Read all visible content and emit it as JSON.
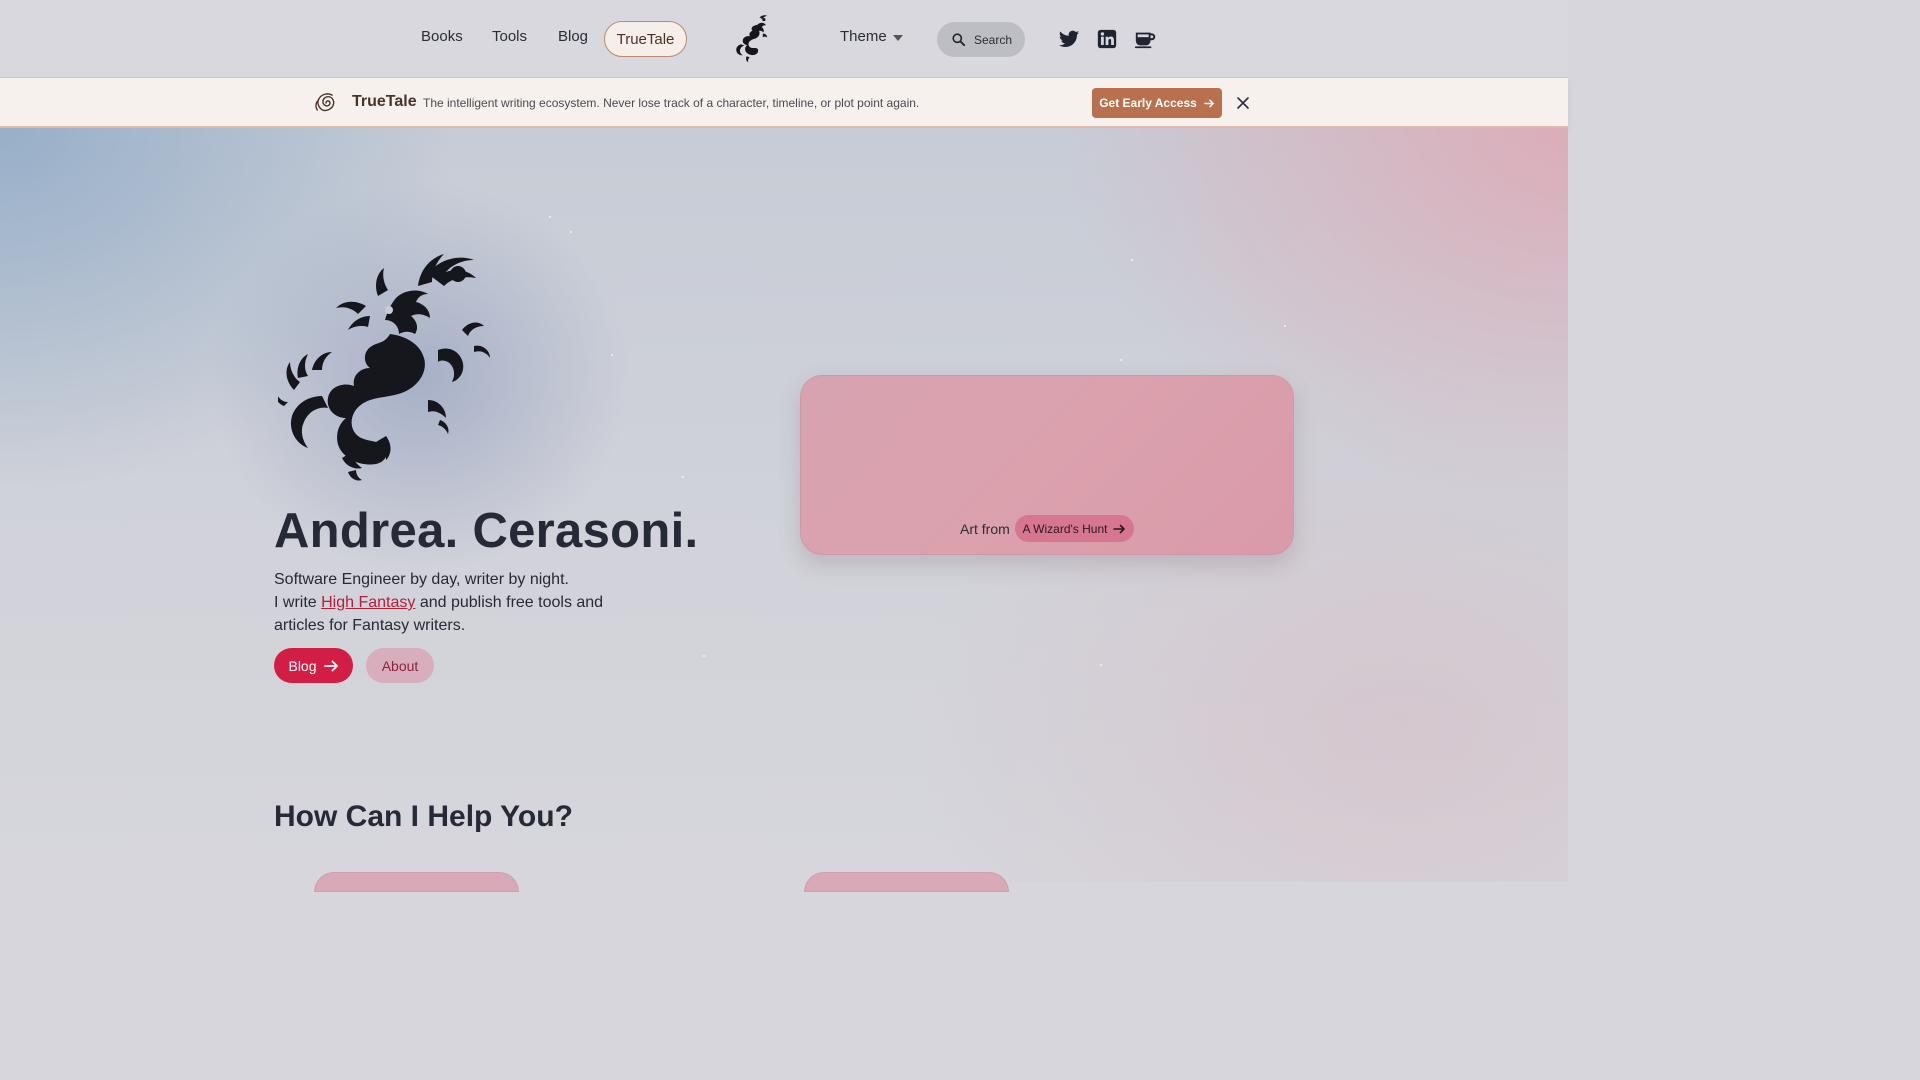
{
  "nav": {
    "links": [
      "Books",
      "Tools",
      "Blog"
    ],
    "highlight": "TrueTale",
    "theme_label": "Theme",
    "search_placeholder": "Search",
    "social": [
      "twitter-icon",
      "linkedin-icon",
      "coffee-icon"
    ]
  },
  "banner": {
    "brand": "TrueTale",
    "text": "The intelligent writing ecosystem. Never lose track of a character, timeline, or plot point again.",
    "cta": "Get Early Access"
  },
  "hero": {
    "title": "Andrea. Cerasoni.",
    "line1": "Software Engineer by day, writer by night.",
    "line2_pre": "I write ",
    "line2_link": "High Fantasy",
    "line2_post": " and publish free tools and articles for Fantasy writers.",
    "btn_blog": "Blog",
    "btn_about": "About"
  },
  "art": {
    "caption": "Art from",
    "link": "A Wizard's Hunt"
  },
  "section": {
    "title": "How Can I Help You?"
  },
  "colors": {
    "primary": "#d21e45",
    "banner_cta": "#b9704e",
    "link": "#b11f3a"
  }
}
